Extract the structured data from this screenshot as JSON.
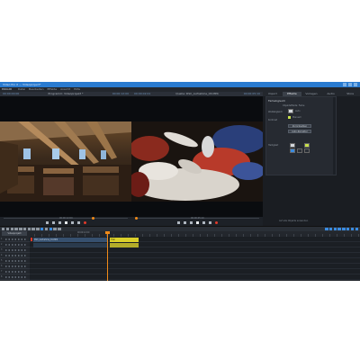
{
  "app": {
    "window_title": "Video Pro X — Videoproject*",
    "brand": "MAGIX",
    "menus": [
      "Datei",
      "Bearbeiten",
      "Effekte",
      "Ansicht",
      "Hilfe"
    ]
  },
  "monitors": {
    "left": {
      "label": "Programm: Videoprojekt *",
      "timecode_right": "00:00:12:00",
      "timecode_left": "00:00:00:00",
      "scrub_timecode": "00:00:12:00"
    },
    "right": {
      "label": "Quelle: DSC_Aufnahme_03.MP4",
      "timecode_right": "00:00:05:10",
      "timecode_left": "00:00:02:01",
      "scrub_timecode": "00:00:05:10"
    }
  },
  "inspector": {
    "tabs": [
      "Import",
      "Effekte",
      "Vorlagen",
      "Audio",
      "Store"
    ],
    "active_tab": "Effekte",
    "panel_title": "Farbabgleich",
    "header_line": "Objekteffekte: Farbe",
    "rows": [
      {
        "label": "Weißabgleich",
        "value": "Auto"
      },
      {
        "label": "Kontrast",
        "value": "Manuell"
      },
      {
        "label": "Helligkeit",
        "value": ""
      }
    ],
    "buttons": [
      "Zurücksetzen",
      "Auto-Korrektur"
    ],
    "footer": "Auf alle Objekte anwenden"
  },
  "timeline": {
    "project_name": "Videoprojekt",
    "ruler_label": "00:00:12:00",
    "tracks": [
      "1",
      "2",
      "3",
      "4",
      "5",
      "6",
      "7",
      "8"
    ],
    "clips": [
      {
        "name": "DSC_Aufnahme_01.MP4",
        "kind": "video"
      },
      {
        "name": "Titel",
        "kind": "title"
      }
    ]
  },
  "icons": {
    "play": "play-icon",
    "stop": "stop-icon",
    "record": "record-icon",
    "rewind": "rewind-icon",
    "forward": "forward-icon"
  },
  "colors": {
    "accent": "#2a7bd0",
    "playhead": "#f08a18",
    "title_clip": "#d9cf2b",
    "video_clip": "#36506e"
  }
}
